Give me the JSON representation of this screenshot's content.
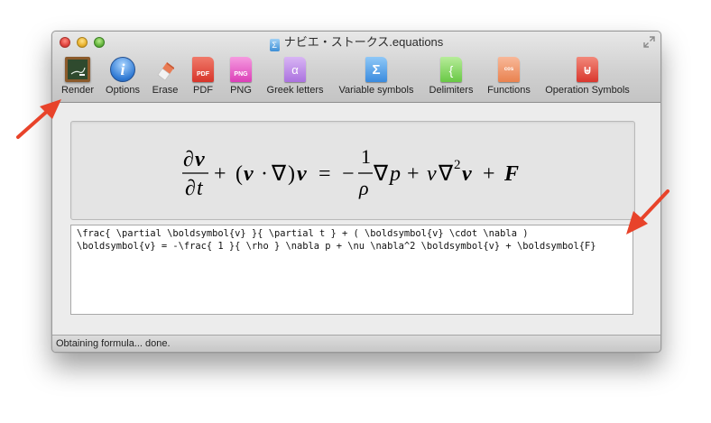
{
  "window": {
    "title": "ナビエ・ストークス.equations"
  },
  "toolbar": {
    "items": [
      {
        "label": "Render",
        "icon": "chalkboard-icon"
      },
      {
        "label": "Options",
        "icon": "info-icon"
      },
      {
        "label": "Erase",
        "icon": "eraser-icon"
      },
      {
        "label": "PDF",
        "icon": "pdf-document-icon",
        "glyph": "PDF"
      },
      {
        "label": "PNG",
        "icon": "png-document-icon",
        "glyph": "PNG"
      },
      {
        "label": "Greek letters",
        "icon": "greek-letters-icon",
        "glyph": "α"
      },
      {
        "label": "Variable symbols",
        "icon": "variable-symbols-icon",
        "glyph": "Σ"
      },
      {
        "label": "Delimiters",
        "icon": "delimiters-icon",
        "glyph": "{"
      },
      {
        "label": "Functions",
        "icon": "functions-icon",
        "glyph": "cos"
      },
      {
        "label": "Operation Symbols",
        "icon": "operation-symbols-icon",
        "glyph": "⊎"
      }
    ]
  },
  "preview": {
    "formula_parts": {
      "partial": "∂",
      "v": "v",
      "t": "t",
      "plus": "+",
      "open_paren": "(",
      "cdot": "·",
      "nabla": "∇",
      "close_paren": ")",
      "equals": "=",
      "minus": "−",
      "one": "1",
      "rho": "ρ",
      "p": "p",
      "nu": "ν",
      "two": "2",
      "F": "F"
    }
  },
  "editor": {
    "source_line1": "\\frac{ \\partial \\boldsymbol{v} }{ \\partial t } + ( \\boldsymbol{v} \\cdot \\nabla )",
    "source_line2": "\\boldsymbol{v} = -\\frac{ 1 }{ \\rho } \\nabla p + \\nu \\nabla^2 \\boldsymbol{v} + \\boldsymbol{F}"
  },
  "status": {
    "text": "Obtaining formula... done."
  },
  "colors": {
    "annotation_arrow": "#e8432a"
  }
}
